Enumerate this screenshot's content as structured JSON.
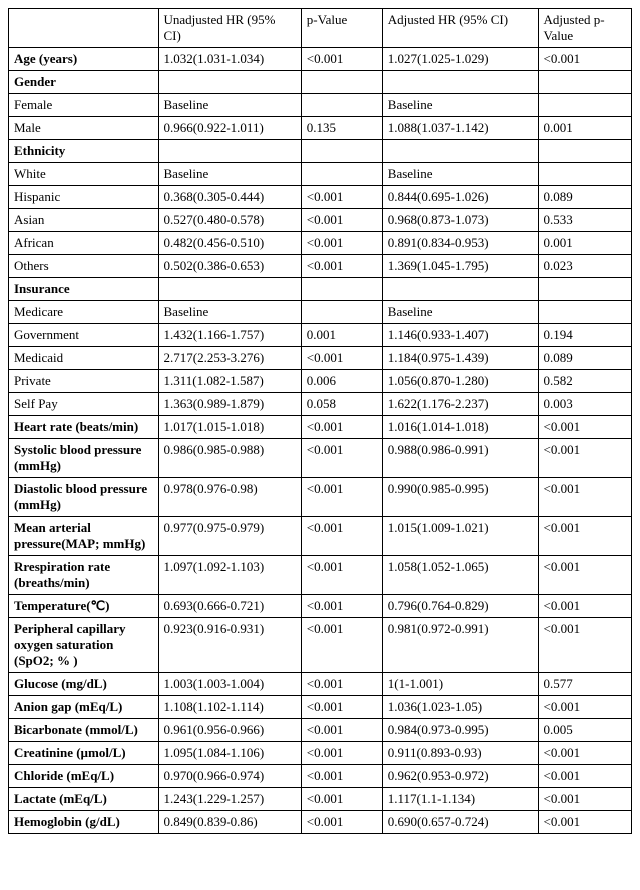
{
  "headers": {
    "col0": "",
    "col1": "Unadjusted HR (95% CI)",
    "col2": "p-Value",
    "col3": "Adjusted HR (95% CI)",
    "col4": "Adjusted p-Value"
  },
  "rows": [
    {
      "bold": true,
      "label": "Age (years)",
      "uhr": "1.032(1.031-1.034)",
      "up": "<0.001",
      "ahr": "1.027(1.025-1.029)",
      "ap": "<0.001"
    },
    {
      "bold": true,
      "label": "Gender",
      "uhr": "",
      "up": "",
      "ahr": "",
      "ap": ""
    },
    {
      "bold": false,
      "label": "Female",
      "uhr": "Baseline",
      "up": "",
      "ahr": "Baseline",
      "ap": ""
    },
    {
      "bold": false,
      "label": "Male",
      "uhr": "0.966(0.922-1.011)",
      "up": "0.135",
      "ahr": "1.088(1.037-1.142)",
      "ap": "0.001"
    },
    {
      "bold": true,
      "label": "Ethnicity",
      "uhr": "",
      "up": "",
      "ahr": "",
      "ap": ""
    },
    {
      "bold": false,
      "label": "White",
      "uhr": "Baseline",
      "up": "",
      "ahr": "Baseline",
      "ap": ""
    },
    {
      "bold": false,
      "label": "Hispanic",
      "uhr": "0.368(0.305-0.444)",
      "up": "<0.001",
      "ahr": "0.844(0.695-1.026)",
      "ap": "0.089"
    },
    {
      "bold": false,
      "label": "Asian",
      "uhr": "0.527(0.480-0.578)",
      "up": "<0.001",
      "ahr": "0.968(0.873-1.073)",
      "ap": "0.533"
    },
    {
      "bold": false,
      "label": "African",
      "uhr": "0.482(0.456-0.510)",
      "up": "<0.001",
      "ahr": "0.891(0.834-0.953)",
      "ap": "0.001"
    },
    {
      "bold": false,
      "label": "Others",
      "uhr": "0.502(0.386-0.653)",
      "up": "<0.001",
      "ahr": "1.369(1.045-1.795)",
      "ap": "0.023"
    },
    {
      "bold": true,
      "label": "Insurance",
      "uhr": "",
      "up": "",
      "ahr": "",
      "ap": ""
    },
    {
      "bold": false,
      "label": "Medicare",
      "uhr": "Baseline",
      "up": "",
      "ahr": "Baseline",
      "ap": ""
    },
    {
      "bold": false,
      "label": "Government",
      "uhr": "1.432(1.166-1.757)",
      "up": "0.001",
      "ahr": "1.146(0.933-1.407)",
      "ap": "0.194"
    },
    {
      "bold": false,
      "label": "Medicaid",
      "uhr": "2.717(2.253-3.276)",
      "up": "<0.001",
      "ahr": "1.184(0.975-1.439)",
      "ap": "0.089"
    },
    {
      "bold": false,
      "label": "Private",
      "uhr": "1.311(1.082-1.587)",
      "up": "0.006",
      "ahr": "1.056(0.870-1.280)",
      "ap": "0.582"
    },
    {
      "bold": false,
      "label": "Self Pay",
      "uhr": "1.363(0.989-1.879)",
      "up": "0.058",
      "ahr": "1.622(1.176-2.237)",
      "ap": "0.003"
    },
    {
      "bold": true,
      "label": "Heart rate (beats/min)",
      "uhr": "1.017(1.015-1.018)",
      "up": "<0.001",
      "ahr": "1.016(1.014-1.018)",
      "ap": "<0.001"
    },
    {
      "bold": true,
      "label": "Systolic blood pressure (mmHg)",
      "uhr": "0.986(0.985-0.988)",
      "up": "<0.001",
      "ahr": "0.988(0.986-0.991)",
      "ap": "<0.001"
    },
    {
      "bold": true,
      "label": "Diastolic blood pressure (mmHg)",
      "uhr": "0.978(0.976-0.98)",
      "up": "<0.001",
      "ahr": "0.990(0.985-0.995)",
      "ap": "<0.001"
    },
    {
      "bold": true,
      "label": "Mean arterial pressure(MAP; mmHg)",
      "uhr": "0.977(0.975-0.979)",
      "up": "<0.001",
      "ahr": "1.015(1.009-1.021)",
      "ap": "<0.001"
    },
    {
      "bold": true,
      "label": "Rrespiration rate (breaths/min)",
      "uhr": "1.097(1.092-1.103)",
      "up": "<0.001",
      "ahr": "1.058(1.052-1.065)",
      "ap": "<0.001"
    },
    {
      "bold": true,
      "label": "Temperature(℃)",
      "uhr": "0.693(0.666-0.721)",
      "up": "<0.001",
      "ahr": "0.796(0.764-0.829)",
      "ap": "<0.001"
    },
    {
      "bold": true,
      "label": "Peripheral capillary oxygen saturation (SpO2; % )",
      "uhr": "0.923(0.916-0.931)",
      "up": "<0.001",
      "ahr": "0.981(0.972-0.991)",
      "ap": "<0.001"
    },
    {
      "bold": true,
      "label": "Glucose (mg/dL)",
      "uhr": "1.003(1.003-1.004)",
      "up": "<0.001",
      "ahr": "1(1-1.001)",
      "ap": "0.577"
    },
    {
      "bold": true,
      "label": "Anion gap (mEq/L)",
      "uhr": "1.108(1.102-1.114)",
      "up": "<0.001",
      "ahr": "1.036(1.023-1.05)",
      "ap": "<0.001"
    },
    {
      "bold": true,
      "label": "Bicarbonate (mmol/L)",
      "uhr": "0.961(0.956-0.966)",
      "up": "<0.001",
      "ahr": "0.984(0.973-0.995)",
      "ap": "0.005"
    },
    {
      "bold": true,
      "label": "Creatinine (µmol/L)",
      "uhr": "1.095(1.084-1.106)",
      "up": "<0.001",
      "ahr": "0.911(0.893-0.93)",
      "ap": "<0.001"
    },
    {
      "bold": true,
      "label": "Chloride (mEq/L)",
      "uhr": "0.970(0.966-0.974)",
      "up": "<0.001",
      "ahr": "0.962(0.953-0.972)",
      "ap": "<0.001"
    },
    {
      "bold": true,
      "label": "Lactate (mEq/L)",
      "uhr": "1.243(1.229-1.257)",
      "up": "<0.001",
      "ahr": "1.117(1.1-1.134)",
      "ap": "<0.001"
    },
    {
      "bold": true,
      "label": "Hemoglobin (g/dL)",
      "uhr": "0.849(0.839-0.86)",
      "up": "<0.001",
      "ahr": "0.690(0.657-0.724)",
      "ap": "<0.001"
    }
  ]
}
